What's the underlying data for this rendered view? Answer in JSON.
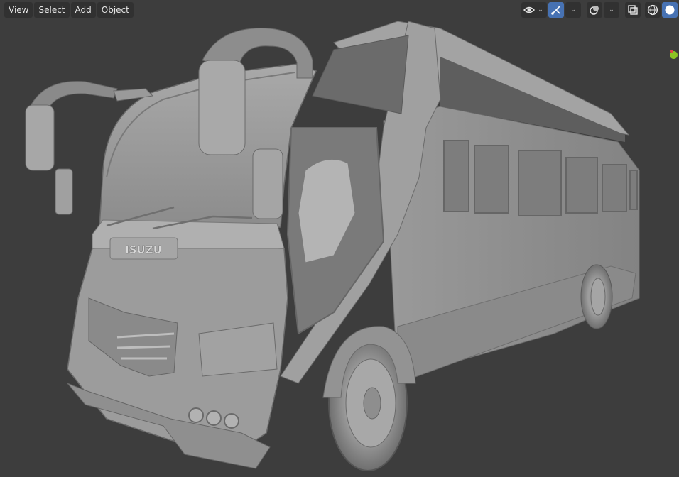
{
  "header": {
    "menus": [
      {
        "id": "view",
        "label": "View"
      },
      {
        "id": "select",
        "label": "Select"
      },
      {
        "id": "add",
        "label": "Add"
      },
      {
        "id": "object",
        "label": "Object"
      }
    ]
  },
  "header_right": {
    "icons": [
      "visibility-eye-icon",
      "gizmo-toggle-icon",
      "overlay-icon",
      "xray-icon",
      "wireframe-shading-icon",
      "solid-shading-icon"
    ]
  },
  "scene": {
    "badge_text": "ISUZU"
  },
  "colors": {
    "background": "#3d3d3d",
    "active_button": "#4772b3",
    "gizmo_green": "#8cc425"
  }
}
